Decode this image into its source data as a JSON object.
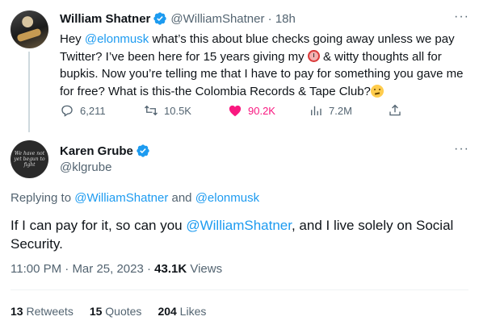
{
  "parent_tweet": {
    "author_name": "William Shatner",
    "author_handle": "@WilliamShatner",
    "separator": "·",
    "time": "18h",
    "more": "···",
    "text": {
      "p1": "Hey ",
      "mention": "@elonmusk",
      "p2": " what’s this about blue checks going away unless we pay Twitter? I’ve been here for 15 years giving my ",
      "p3": " & witty thoughts all for bupkis. Now you’re telling me that I have to pay for something you gave me for free? What is this-the Colombia Records & Tape Club?"
    },
    "emojis": [
      "alarm-clock",
      "thinking-face"
    ],
    "actions": {
      "replies": "6,211",
      "retweets": "10.5K",
      "likes": "90.2K",
      "views": "7.2M"
    },
    "like_color": "#f91880"
  },
  "focal_tweet": {
    "author_name": "Karen Grube",
    "author_handle": "@klgrube",
    "more": "···",
    "avatar_text": "We have not yet begun to fight",
    "replying_prefix": "Replying to ",
    "replying_to_1": "@WilliamShatner",
    "replying_and": " and ",
    "replying_to_2": "@elonmusk",
    "text": {
      "p1": "If I can pay for it, so can you ",
      "mention": "@WilliamShatner",
      "p2": ", and I live solely on Social Security."
    },
    "time": "11:00 PM",
    "separator": " · ",
    "date": "Mar 25, 2023",
    "views_count": "43.1K",
    "views_label": " Views",
    "stats": {
      "retweets_count": "13",
      "retweets_label": " Retweets",
      "quotes_count": "15",
      "quotes_label": " Quotes",
      "likes_count": "204",
      "likes_label": " Likes"
    }
  },
  "colors": {
    "link": "#1d9bf0",
    "verified": "#1d9bf0",
    "muted": "#536471"
  }
}
